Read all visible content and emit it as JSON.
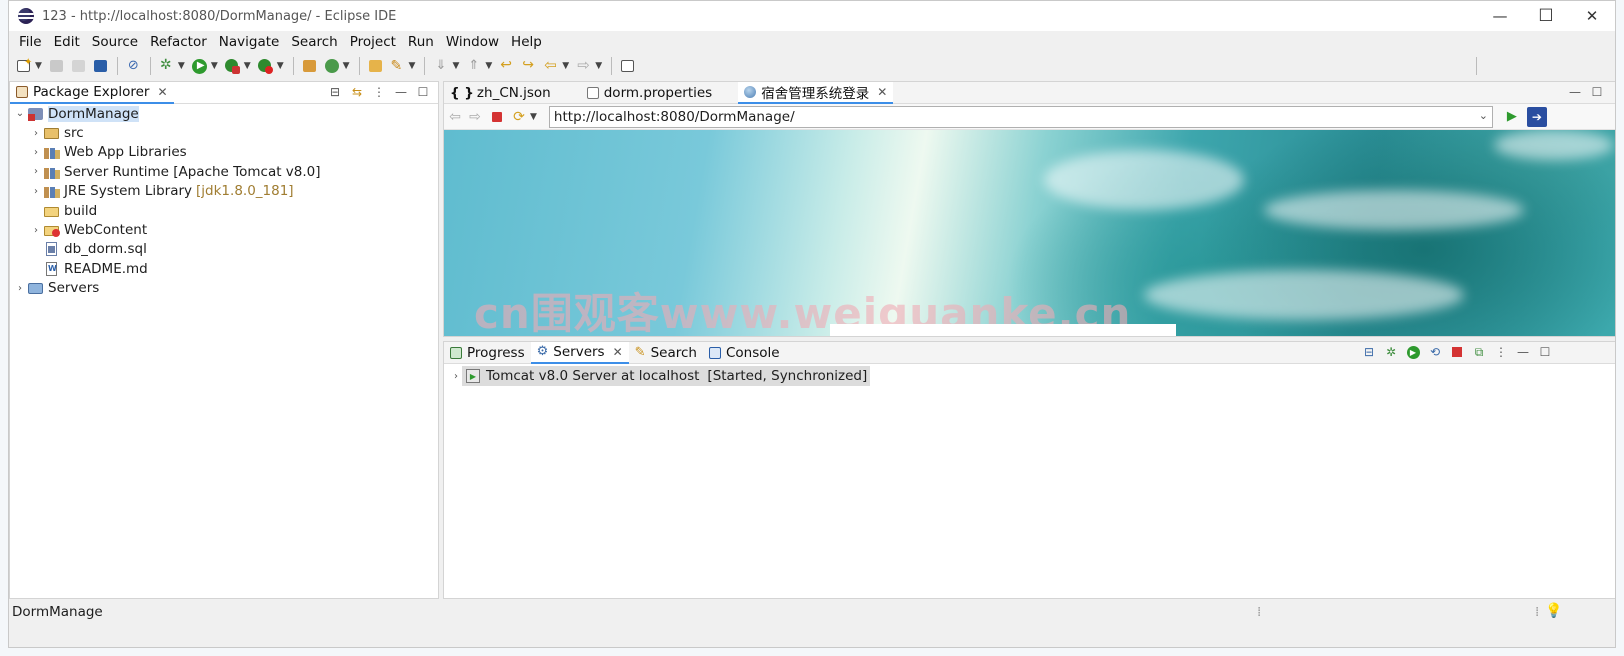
{
  "window": {
    "title": "123 - http://localhost:8080/DormManage/ - Eclipse IDE",
    "minimize": "—",
    "maximize": "☐",
    "close": "✕"
  },
  "menu": [
    "File",
    "Edit",
    "Source",
    "Refactor",
    "Navigate",
    "Search",
    "Project",
    "Run",
    "Window",
    "Help"
  ],
  "package_explorer": {
    "tab_label": "Package Explorer",
    "tree": [
      {
        "label": "DormManage",
        "level": 0,
        "expanded": true,
        "icon": "project-icon"
      },
      {
        "label": "src",
        "level": 1,
        "expanded": false,
        "icon": "source-folder-icon"
      },
      {
        "label": "Web App Libraries",
        "level": 1,
        "expanded": false,
        "icon": "library-icon"
      },
      {
        "label": "Server Runtime [Apache Tomcat v8.0]",
        "level": 1,
        "expanded": false,
        "icon": "library-icon"
      },
      {
        "label": "JRE System Library",
        "decoration": "[jdk1.8.0_181]",
        "level": 1,
        "expanded": false,
        "icon": "library-icon"
      },
      {
        "label": "build",
        "level": 1,
        "expanded": null,
        "icon": "folder-icon"
      },
      {
        "label": "WebContent",
        "level": 1,
        "expanded": false,
        "icon": "web-folder-icon"
      },
      {
        "label": "db_dorm.sql",
        "level": 1,
        "expanded": null,
        "icon": "sql-file-icon"
      },
      {
        "label": "README.md",
        "level": 1,
        "expanded": null,
        "icon": "markdown-file-icon"
      },
      {
        "label": "Servers",
        "level": 0,
        "expanded": false,
        "icon": "servers-project-icon"
      }
    ]
  },
  "editor": {
    "tabs": [
      {
        "label": "zh_CN.json",
        "icon": "{ }"
      },
      {
        "label": "dorm.properties",
        "icon": "file"
      },
      {
        "label": "宿舍管理系统登录",
        "icon": "globe",
        "active": true
      }
    ],
    "url": "http://localhost:8080/DormManage/",
    "watermark": "cn围观客www.weiguanke.cn"
  },
  "bottom_panel": {
    "tabs": [
      {
        "label": "Progress",
        "icon": "progress-icon"
      },
      {
        "label": "Servers",
        "icon": "servers-icon",
        "active": true
      },
      {
        "label": "Search",
        "icon": "search-icon"
      },
      {
        "label": "Console",
        "icon": "console-icon"
      }
    ],
    "server_entry": {
      "name": "Tomcat v8.0 Server at localhost",
      "state": "[Started, Synchronized]"
    }
  },
  "status": {
    "text": "DormManage"
  }
}
